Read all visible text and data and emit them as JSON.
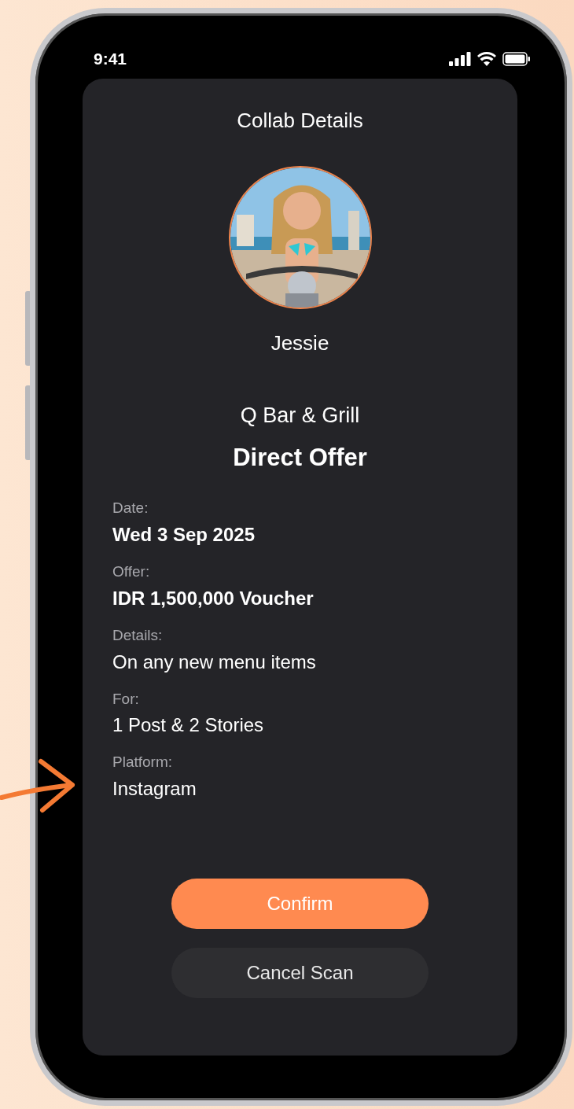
{
  "status_bar": {
    "time": "9:41"
  },
  "screen": {
    "title": "Collab Details",
    "profile": {
      "name": "Jessie"
    },
    "venue": "Q Bar & Grill",
    "offer_type": "Direct Offer",
    "fields": [
      {
        "label": "Date:",
        "value": "Wed 3 Sep 2025",
        "emphasized": true
      },
      {
        "label": "Offer:",
        "value": "IDR 1,500,000 Voucher",
        "emphasized": true
      },
      {
        "label": "Details:",
        "value": "On any new menu items",
        "emphasized": false
      },
      {
        "label": "For:",
        "value": "1 Post & 2 Stories",
        "emphasized": false
      },
      {
        "label": "Platform:",
        "value": "Instagram",
        "emphasized": false
      }
    ],
    "buttons": [
      {
        "label": "Confirm",
        "kind": "primary"
      },
      {
        "label": "Cancel Scan",
        "kind": "secondary"
      }
    ]
  }
}
